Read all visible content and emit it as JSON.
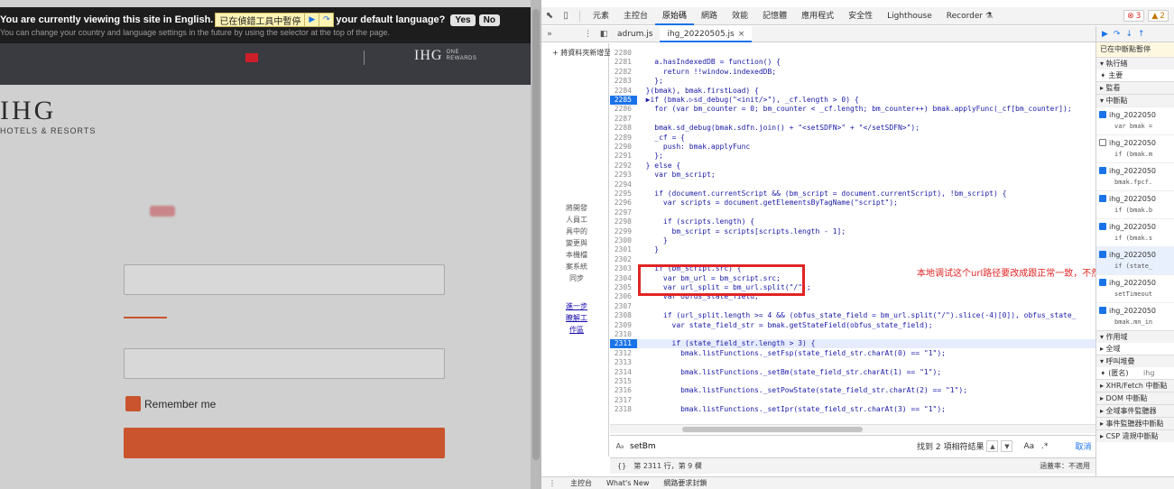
{
  "site": {
    "banner_line1_pre": "You are currently viewing this site in English.",
    "paused_label": "已在偵錯工具中暫停",
    "banner_line1_post": "your default language?",
    "yes_label": "Yes",
    "no_label": "No",
    "banner_line2": "You can change your country and language settings in the future by using the selector at the top of the page.",
    "logo_small": "IHG",
    "one_rewards": "ONE\nREWARDS",
    "logo_main": "IHG",
    "logo_sub": "HOTELS & RESORTS",
    "remember_label": "Remember me"
  },
  "devtools": {
    "tabs": [
      "元素",
      "主控台",
      "原始碼",
      "網路",
      "效能",
      "記憶體",
      "應用程式",
      "安全性",
      "Lighthouse",
      "Recorder ⚗"
    ],
    "active_tab": "原始碼",
    "badge_errors": "3",
    "badge_warnings": "2",
    "files": [
      "adrum.js",
      "ihg_20220505.js"
    ],
    "nav_add_workspace": "+ 將資料夾新增至工作區",
    "nav_desc": "將開發人員工具中的變更與本機檔案系統同步",
    "nav_link": "進一步瞭解工作區",
    "annotation": "本地调试这个url路径要改成跟正常一致，不然通过不了校验",
    "search_value": "setBm",
    "search_result": "找到 2 項相符結果",
    "search_aa": "Aa",
    "search_regex": ".*",
    "search_cancel": "取消",
    "status_position": "第 2311 行，第 9 欄",
    "status_coverage": "涵蓋率：不適用",
    "drawer": [
      "主控台",
      "What's New",
      "網路要求封鎖"
    ],
    "debugger": {
      "paused_note": "已在中斷點暫停",
      "threads": "▾ 執行緒",
      "main_thread": "➧ 主要",
      "watch": "▸ 監看",
      "breakpoints": "▾ 中斷點",
      "bp_items": [
        {
          "file": "ihg_2022050",
          "code": "var bmak =",
          "checked": true,
          "hit": false
        },
        {
          "file": "ihg_2022050",
          "code": "if (bmak.m",
          "checked": false,
          "hit": false
        },
        {
          "file": "ihg_2022050",
          "code": "bmak.fpcf.",
          "checked": true,
          "hit": false
        },
        {
          "file": "ihg_2022050",
          "code": "if (bmak.b",
          "checked": true,
          "hit": false
        },
        {
          "file": "ihg_2022050",
          "code": "if (bmak.s",
          "checked": true,
          "hit": false
        },
        {
          "file": "ihg_2022050",
          "code": "if (state_",
          "checked": true,
          "hit": true
        },
        {
          "file": "ihg_2022050",
          "code": "setTimeout",
          "checked": true,
          "hit": false
        },
        {
          "file": "ihg_2022050",
          "code": "bmak.mn_in",
          "checked": true,
          "hit": false
        }
      ],
      "scope": "▾ 作用域",
      "global": "▸ 全域",
      "callstack": "▾ 呼叫堆疊",
      "anon_frame": "➧ (匿名)",
      "anon_src": "ihg",
      "xhr": "▸ XHR/Fetch 中斷點",
      "dom": "▸ DOM 中斷點",
      "global_listeners": "▸ 全域事件監聽器",
      "event_listeners": "▸ 事件監聽器中斷點",
      "csp": "▸ CSP 違規中斷點"
    },
    "code_lines": [
      {
        "n": "2280",
        "t": "",
        "bp": false
      },
      {
        "n": "2281",
        "t": "    a.hasIndexedDB = function() {",
        "bp": false
      },
      {
        "n": "2282",
        "t": "      return !!window.indexedDB;",
        "bp": false
      },
      {
        "n": "2283",
        "t": "    };",
        "bp": false
      },
      {
        "n": "2284",
        "t": "  }(bmak), bmak.firstLoad) {",
        "bp": false
      },
      {
        "n": "2285",
        "t": "  ▶if (bmak.▷sd_debug(\"<init/>\"), _cf.length > 0) {",
        "bp": true
      },
      {
        "n": "2286",
        "t": "    for (var bm_counter = 0; bm_counter < _cf.length; bm_counter++) bmak.applyFunc(_cf[bm_counter]);",
        "bp": false
      },
      {
        "n": "2287",
        "t": "",
        "bp": false
      },
      {
        "n": "2288",
        "t": "    bmak.sd_debug(bmak.sdfn.join() + \"<setSDFN>\" + \"</setSDFN>\");",
        "bp": false
      },
      {
        "n": "2289",
        "t": "    _cf = {",
        "bp": false
      },
      {
        "n": "2290",
        "t": "      push: bmak.applyFunc",
        "bp": false
      },
      {
        "n": "2291",
        "t": "    };",
        "bp": false
      },
      {
        "n": "2292",
        "t": "  } else {",
        "bp": false
      },
      {
        "n": "2293",
        "t": "    var bm_script;",
        "bp": false
      },
      {
        "n": "2294",
        "t": "",
        "bp": false
      },
      {
        "n": "2295",
        "t": "    if (document.currentScript && (bm_script = document.currentScript), !bm_script) {",
        "bp": false
      },
      {
        "n": "2296",
        "t": "      var scripts = document.getElementsByTagName(\"script\");",
        "bp": false
      },
      {
        "n": "2297",
        "t": "",
        "bp": false
      },
      {
        "n": "2298",
        "t": "      if (scripts.length) {",
        "bp": false
      },
      {
        "n": "2299",
        "t": "        bm_script = scripts[scripts.length - 1];",
        "bp": false
      },
      {
        "n": "2300",
        "t": "      }",
        "bp": false
      },
      {
        "n": "2301",
        "t": "    }",
        "bp": false
      },
      {
        "n": "2302",
        "t": "",
        "bp": false
      },
      {
        "n": "2303",
        "t": "    if (bm_script.src) {",
        "bp": false
      },
      {
        "n": "2304",
        "t": "      var bm_url = bm_script.src;",
        "bp": false
      },
      {
        "n": "2305",
        "t": "      var url_split = bm_url.split(\"/\");",
        "bp": false
      },
      {
        "n": "2306",
        "t": "      var obfus_state_field;",
        "bp": false
      },
      {
        "n": "2307",
        "t": "",
        "bp": false
      },
      {
        "n": "2308",
        "t": "      if (url_split.length >= 4 && (obfus_state_field = bm_url.split(\"/\").slice(-4)[0]), obfus_state_",
        "bp": false
      },
      {
        "n": "2309",
        "t": "        var state_field_str = bmak.getStateField(obfus_state_field);",
        "bp": false
      },
      {
        "n": "2310",
        "t": "",
        "bp": false
      },
      {
        "n": "2311",
        "t": "        if (state_field_str.length > 3) {",
        "bp": true
      },
      {
        "n": "2312",
        "t": "          bmak.listFunctions._setFsp(state_field_str.charAt(0) == \"1\");",
        "bp": false
      },
      {
        "n": "2313",
        "t": "",
        "bp": false
      },
      {
        "n": "2314",
        "t": "          bmak.listFunctions._setBm(state_field_str.charAt(1) == \"1\");",
        "bp": false
      },
      {
        "n": "2315",
        "t": "",
        "bp": false
      },
      {
        "n": "2316",
        "t": "          bmak.listFunctions._setPowState(state_field_str.charAt(2) == \"1\");",
        "bp": false
      },
      {
        "n": "2317",
        "t": "",
        "bp": false
      },
      {
        "n": "2318",
        "t": "          bmak.listFunctions._setIpr(state_field_str.charAt(3) == \"1\");",
        "bp": false
      }
    ]
  }
}
